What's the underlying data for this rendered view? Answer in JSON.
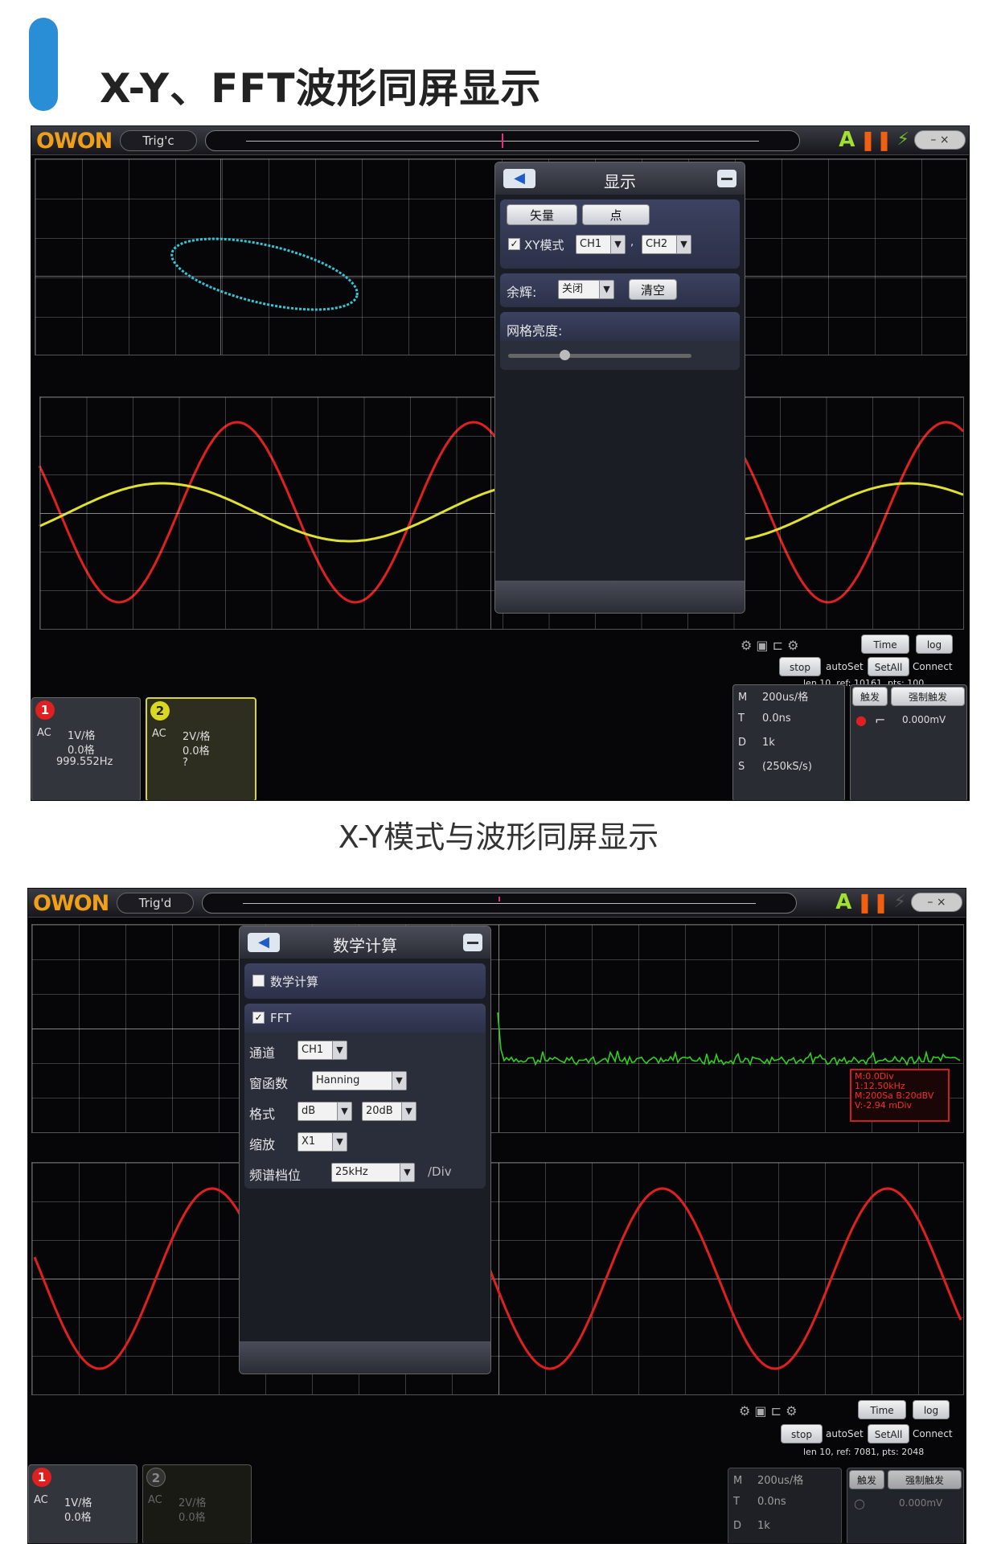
{
  "page": {
    "heading": "X-Y、FFT波形同屏显示",
    "caption": "X-Y模式与波形同屏显示"
  },
  "colors": {
    "accent": "#2a8ed6",
    "ch1_wave": "#e02020",
    "ch2_wave": "#e0e030",
    "xy_trace": "#30c8d8",
    "fft_trace": "#30d020"
  },
  "scope1": {
    "logo": "OWON",
    "trig_status": "Trig'c",
    "panel": {
      "title": "显示",
      "btn_vector": "矢量",
      "btn_dot": "点",
      "xy_label": "XY模式",
      "xy_ch_a": "CH1",
      "xy_ch_b": "CH2",
      "persist_label": "余辉:",
      "persist_value": "关闭",
      "clear_btn": "清空",
      "grid_brightness_label": "网格亮度:"
    },
    "status": {
      "ch1_num": "1",
      "ch1_coupling": "AC",
      "ch1_scale": "1V/格",
      "ch1_offset": "0.0格",
      "ch1_freq": "999.552Hz",
      "ch2_num": "2",
      "ch2_coupling": "AC",
      "ch2_scale": "2V/格",
      "ch2_offset": "0.0格",
      "ch2_extra": "?",
      "btn_time": "Time",
      "btn_log": "log",
      "btn_stop": "stop",
      "autoset": "autoSet",
      "btn_setall": "SetAll",
      "connect": "Connect",
      "timebase_row": [
        {
          "k": "M",
          "v": "200us/格"
        },
        {
          "k": "T",
          "v": "0.0ns"
        },
        {
          "k": "D",
          "v": "1k"
        },
        {
          "k": "S",
          "v": "(250kS/s)"
        }
      ],
      "btn_trigger": "触发",
      "btn_force": "强制触发",
      "trig_level": "0.000mV",
      "mem_info": "len 10, ref: 10161, pts: 100"
    }
  },
  "scope2": {
    "logo": "OWON",
    "trig_status": "Trig'd",
    "panel": {
      "title": "数学计算",
      "math_label": "数学计算",
      "fft_label": "FFT",
      "channel_label": "通道",
      "channel_value": "CH1",
      "window_label": "窗函数",
      "window_value": "Hanning",
      "format_label": "格式",
      "format_value": "dB",
      "format_db": "20dB",
      "zoom_label": "缩放",
      "zoom_value": "X1",
      "spectrum_label": "频谱档位",
      "spectrum_value": "25kHz",
      "per_div": "/Div"
    },
    "fft_info": {
      "l1": "M:0.0Div",
      "l2": "1:12.50kHz",
      "l3": "M:200Sa  B:20dBV",
      "l4": "V:-2.94 mDiv"
    },
    "status": {
      "ch1_num": "1",
      "ch1_coupling": "AC",
      "ch1_scale": "1V/格",
      "ch1_offset": "0.0格",
      "ch2_num": "2",
      "ch2_coupling": "AC",
      "ch2_scale": "2V/格",
      "ch2_offset": "0.0格",
      "btn_time": "Time",
      "btn_log": "log",
      "btn_stop": "stop",
      "autoset": "autoSet",
      "btn_setall": "SetAll",
      "connect": "Connect",
      "timebase_row": [
        {
          "k": "M",
          "v": "200us/格"
        },
        {
          "k": "T",
          "v": "0.0ns"
        },
        {
          "k": "D",
          "v": "1k"
        }
      ],
      "btn_trigger": "触发",
      "btn_force": "强制触发",
      "trig_level": "0.000mV",
      "mem_info": "len 10, ref: 7081, pts: 2048"
    }
  }
}
